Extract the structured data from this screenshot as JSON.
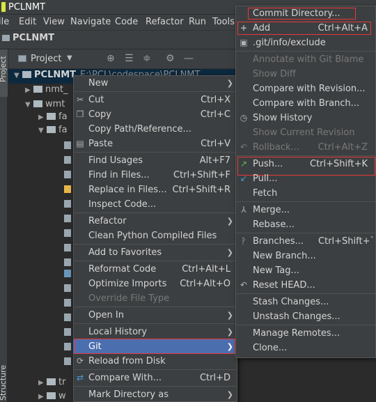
{
  "window": {
    "title": "PCLNMT"
  },
  "menubar": [
    {
      "label": "File",
      "display": "ile"
    },
    {
      "label": "Edit",
      "display": "Edit"
    },
    {
      "label": "View",
      "display": "View"
    },
    {
      "label": "Navigate",
      "display": "Navigate"
    },
    {
      "label": "Code",
      "display": "Code"
    },
    {
      "label": "Refactor",
      "display": "Refactor"
    },
    {
      "label": "Run",
      "display": "Run"
    },
    {
      "label": "Tools",
      "display": "Tools"
    }
  ],
  "navbar": {
    "project": "PCLNMT"
  },
  "side_tabs": {
    "project": "Project",
    "structure": "Structure"
  },
  "project_panel": {
    "dropdown_label": "Project",
    "tree": [
      {
        "label": "PCLNMT",
        "path": "E:\\PCL\\codespace\\PCLNMT",
        "selected": true
      },
      {
        "label": "nmt_"
      },
      {
        "label": "wmt"
      },
      {
        "label": "fa"
      },
      {
        "label": "fa"
      },
      {
        "label": "tr"
      },
      {
        "label": "w"
      }
    ]
  },
  "context_menu": {
    "items": [
      {
        "label": "New",
        "submenu": true
      },
      {
        "label": "Cut",
        "shortcut": "Ctrl+X",
        "icon": "scissors-icon"
      },
      {
        "label": "Copy",
        "shortcut": "Ctrl+C",
        "icon": "copy-icon"
      },
      {
        "label": "Copy Path/Reference..."
      },
      {
        "label": "Paste",
        "shortcut": "Ctrl+V",
        "icon": "paste-icon"
      },
      {
        "label": "Find Usages",
        "shortcut": "Alt+F7"
      },
      {
        "label": "Find in Files...",
        "shortcut": "Ctrl+Shift+F"
      },
      {
        "label": "Replace in Files...",
        "shortcut": "Ctrl+Shift+R"
      },
      {
        "label": "Inspect Code..."
      },
      {
        "label": "Refactor",
        "submenu": true
      },
      {
        "label": "Clean Python Compiled Files"
      },
      {
        "label": "Add to Favorites",
        "submenu": true
      },
      {
        "label": "Reformat Code",
        "shortcut": "Ctrl+Alt+L"
      },
      {
        "label": "Optimize Imports",
        "shortcut": "Ctrl+Alt+O"
      },
      {
        "label": "Override File Type",
        "disabled": true
      },
      {
        "label": "Open In",
        "submenu": true
      },
      {
        "label": "Local History",
        "submenu": true
      },
      {
        "label": "Git",
        "submenu": true,
        "highlighted": true
      },
      {
        "label": "Reload from Disk",
        "icon": "reload-icon"
      },
      {
        "label": "Compare With...",
        "shortcut": "Ctrl+D",
        "icon": "compare-icon"
      },
      {
        "label": "Mark Directory as",
        "submenu": true
      }
    ]
  },
  "git_menu": {
    "items": [
      {
        "label": "Commit Directory..."
      },
      {
        "label": "Add",
        "shortcut": "Ctrl+Alt+A",
        "icon": "plus-icon"
      },
      {
        "label": ".git/info/exclude",
        "icon": "file-icon"
      },
      {
        "label": "Annotate with Git Blame",
        "disabled": true
      },
      {
        "label": "Show Diff",
        "disabled": true
      },
      {
        "label": "Compare with Revision..."
      },
      {
        "label": "Compare with Branch..."
      },
      {
        "label": "Show History",
        "icon": "clock-icon"
      },
      {
        "label": "Show Current Revision",
        "disabled": true
      },
      {
        "label": "Rollback...",
        "shortcut": "Ctrl+Alt+Z",
        "disabled": true,
        "icon": "undo-icon"
      },
      {
        "label": "Push...",
        "shortcut": "Ctrl+Shift+K",
        "icon": "push-arrow-icon"
      },
      {
        "label": "Pull...",
        "icon": "pull-arrow-icon"
      },
      {
        "label": "Fetch"
      },
      {
        "label": "Merge...",
        "icon": "merge-icon"
      },
      {
        "label": "Rebase..."
      },
      {
        "label": "Branches...",
        "shortcut": "Ctrl+Shift+`",
        "icon": "branch-icon"
      },
      {
        "label": "New Branch..."
      },
      {
        "label": "New Tag..."
      },
      {
        "label": "Reset HEAD...",
        "icon": "undo-icon"
      },
      {
        "label": "Stash Changes..."
      },
      {
        "label": "Unstash Changes..."
      },
      {
        "label": "Manage Remotes..."
      },
      {
        "label": "Clone..."
      }
    ]
  },
  "colors": {
    "background": "#2b2b2b",
    "panel": "#3c3f41",
    "highlight": "#4b6eaf",
    "annotation_red": "#e63838"
  }
}
